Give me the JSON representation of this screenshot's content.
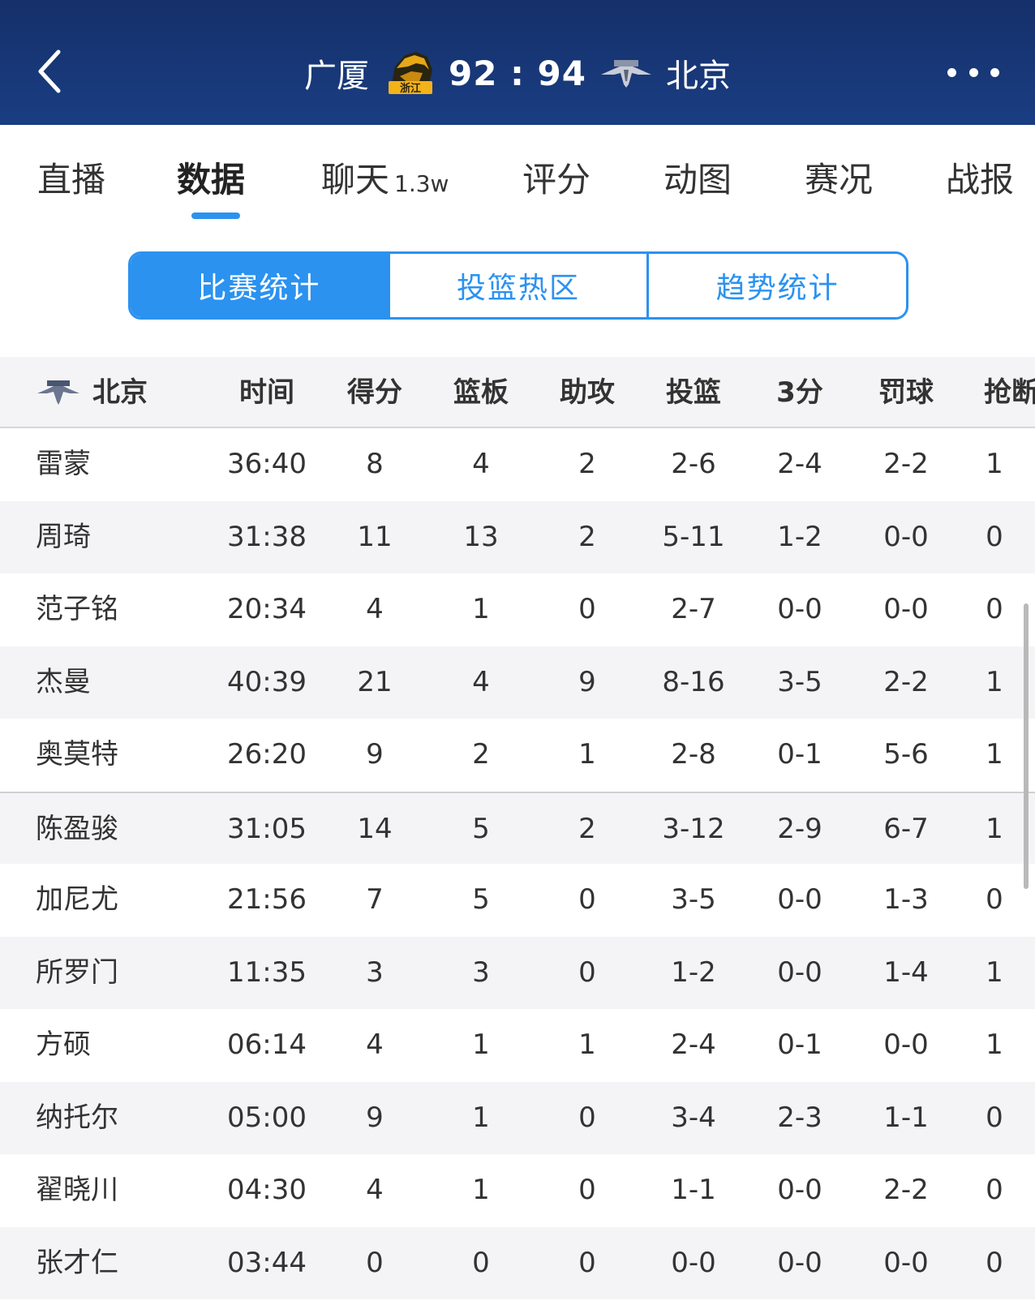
{
  "header": {
    "home_team": "广厦",
    "score": "92 : 94",
    "away_team": "北京",
    "home_logo_text": "浙江"
  },
  "tabs": [
    {
      "label": "直播",
      "sub": ""
    },
    {
      "label": "数据",
      "sub": ""
    },
    {
      "label": "聊天",
      "sub": "1.3w"
    },
    {
      "label": "评分",
      "sub": ""
    },
    {
      "label": "动图",
      "sub": ""
    },
    {
      "label": "赛况",
      "sub": ""
    },
    {
      "label": "战报",
      "sub": ""
    }
  ],
  "active_tab": "数据",
  "segments": [
    "比赛统计",
    "投篮热区",
    "趋势统计"
  ],
  "table": {
    "team": "北京",
    "columns": [
      "时间",
      "得分",
      "篮板",
      "助攻",
      "投篮",
      "3分",
      "罚球",
      "抢断"
    ],
    "rows": [
      [
        "雷蒙",
        "36:40",
        "8",
        "4",
        "2",
        "2-6",
        "2-4",
        "2-2",
        "1"
      ],
      [
        "周琦",
        "31:38",
        "11",
        "13",
        "2",
        "5-11",
        "1-2",
        "0-0",
        "0"
      ],
      [
        "范子铭",
        "20:34",
        "4",
        "1",
        "0",
        "2-7",
        "0-0",
        "0-0",
        "0"
      ],
      [
        "杰曼",
        "40:39",
        "21",
        "4",
        "9",
        "8-16",
        "3-5",
        "2-2",
        "1"
      ],
      [
        "奥莫特",
        "26:20",
        "9",
        "2",
        "1",
        "2-8",
        "0-1",
        "5-6",
        "1"
      ],
      [
        "陈盈骏",
        "31:05",
        "14",
        "5",
        "2",
        "3-12",
        "2-9",
        "6-7",
        "1"
      ],
      [
        "加尼尤",
        "21:56",
        "7",
        "5",
        "0",
        "3-5",
        "0-0",
        "1-3",
        "0"
      ],
      [
        "所罗门",
        "11:35",
        "3",
        "3",
        "0",
        "1-2",
        "0-0",
        "1-4",
        "1"
      ],
      [
        "方硕",
        "06:14",
        "4",
        "1",
        "1",
        "2-4",
        "0-1",
        "0-0",
        "1"
      ],
      [
        "纳托尔",
        "05:00",
        "9",
        "1",
        "0",
        "3-4",
        "2-3",
        "1-1",
        "0"
      ],
      [
        "翟晓川",
        "04:30",
        "4",
        "1",
        "0",
        "1-1",
        "0-0",
        "2-2",
        "0"
      ],
      [
        "张才仁",
        "03:44",
        "0",
        "0",
        "0",
        "0-0",
        "0-0",
        "0-0",
        "0"
      ]
    ]
  },
  "colors": {
    "header_bg": "#1a3d82",
    "accent": "#2b92f0",
    "row_alt": "#f4f4f6"
  }
}
